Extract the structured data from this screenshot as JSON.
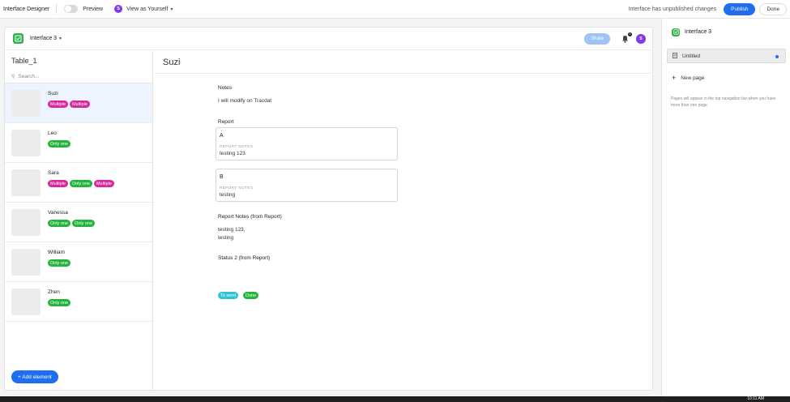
{
  "topbar": {
    "title": "Interface Designer",
    "preview_label": "Preview",
    "avatar_initial": "S",
    "view_as": "View as Yourself",
    "unpublished": "Interface has unpublished changes",
    "publish": "Publish",
    "done": "Done"
  },
  "canvas": {
    "interface_name": "Interface 3",
    "share": "Share",
    "notification_count": "1",
    "user_initial": "S"
  },
  "list": {
    "title": "Table_1",
    "search_placeholder": "Search...",
    "add_element": "+ Add element",
    "records": [
      {
        "name": "Suzi",
        "tags": [
          {
            "label": "Multiple",
            "kind": "multi"
          },
          {
            "label": "Multiple",
            "kind": "multi"
          }
        ],
        "selected": true
      },
      {
        "name": "Leo",
        "tags": [
          {
            "label": "Only one",
            "kind": "one"
          }
        ]
      },
      {
        "name": "Sara",
        "tags": [
          {
            "label": "Multiple",
            "kind": "multi"
          },
          {
            "label": "Only one",
            "kind": "one"
          },
          {
            "label": "Multiple",
            "kind": "multi"
          }
        ]
      },
      {
        "name": "Vanessa",
        "tags": [
          {
            "label": "Only one",
            "kind": "one"
          },
          {
            "label": "Only one",
            "kind": "one"
          }
        ]
      },
      {
        "name": "William",
        "tags": [
          {
            "label": "Only one",
            "kind": "one"
          }
        ]
      },
      {
        "name": "Zhen",
        "tags": [
          {
            "label": "Only one",
            "kind": "one"
          }
        ]
      }
    ]
  },
  "detail": {
    "title": "Suzi",
    "notes_label": "Notes",
    "notes_value": "I will modify on Tracdat",
    "report_label": "Report",
    "reports": [
      {
        "name": "A",
        "sub": "REPORT NOTES",
        "value": "testing 123"
      },
      {
        "name": "B",
        "sub": "REPORT NOTES",
        "value": "testing"
      }
    ],
    "report_notes_label": "Report Notes (from Report)",
    "report_notes_line1": "testing 123,",
    "report_notes_line2": "testing",
    "status_label": "Status 2 (from Report)",
    "status_tags": [
      {
        "label": "To send",
        "color": "#2ec4d4"
      },
      {
        "label": "Done",
        "color": "#24b43b"
      }
    ]
  },
  "right_panel": {
    "title": "Interface 3",
    "page": "Untitled",
    "new_page": "New page",
    "help": "Pages will appear in the top navigation bar when you have more than one page."
  },
  "taskbar": {
    "time": "10:11 AM"
  },
  "colors": {
    "accent": "#1d6ef0",
    "multiple_tag": "#d9279d",
    "only_one_tag": "#24b43b",
    "app_icon": "#2fb24c",
    "avatar": "#7c3aed"
  }
}
